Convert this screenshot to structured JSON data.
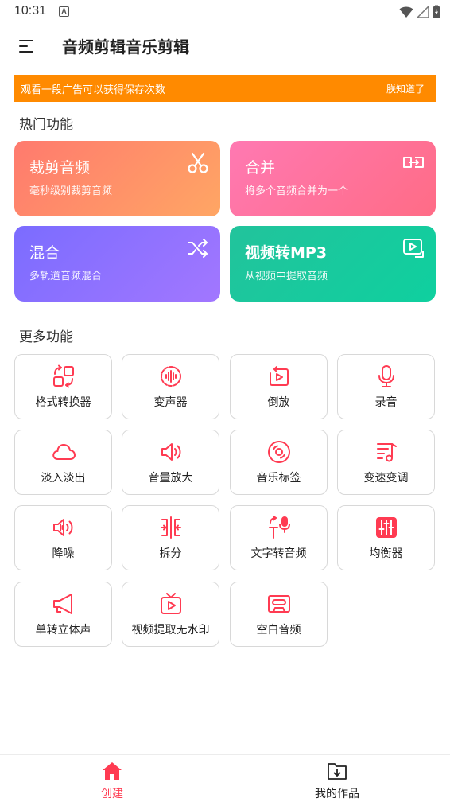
{
  "status_bar": {
    "time": "10:31",
    "notification_letter": "A"
  },
  "app_bar": {
    "title": "音频剪辑音乐剪辑"
  },
  "banner": {
    "text": "观看一段广告可以获得保存次数",
    "button": "朕知道了"
  },
  "hot_section": {
    "title": "热门功能",
    "cards": [
      {
        "title": "裁剪音频",
        "subtitle": "毫秒级别裁剪音频",
        "icon": "scissors-icon"
      },
      {
        "title": "合并",
        "subtitle": "将多个音频合并为一个",
        "icon": "merge-icon"
      },
      {
        "title": "混合",
        "subtitle": "多轨道音频混合",
        "icon": "shuffle-icon"
      },
      {
        "title": "视频转MP3",
        "subtitle": "从视频中提取音频",
        "icon": "video-to-audio-icon"
      }
    ]
  },
  "more_section": {
    "title": "更多功能",
    "tools": [
      {
        "label": "格式转换器",
        "icon": "format-convert-icon"
      },
      {
        "label": "变声器",
        "icon": "voice-changer-icon"
      },
      {
        "label": "倒放",
        "icon": "reverse-play-icon"
      },
      {
        "label": "录音",
        "icon": "microphone-icon"
      },
      {
        "label": "淡入淡出",
        "icon": "cloud-icon"
      },
      {
        "label": "音量放大",
        "icon": "volume-icon"
      },
      {
        "label": "音乐标签",
        "icon": "disc-icon"
      },
      {
        "label": "变速变调",
        "icon": "music-note-icon"
      },
      {
        "label": "降噪",
        "icon": "noise-reduction-icon"
      },
      {
        "label": "拆分",
        "icon": "split-icon"
      },
      {
        "label": "文字转音频",
        "icon": "text-to-speech-icon"
      },
      {
        "label": "均衡器",
        "icon": "equalizer-icon"
      },
      {
        "label": "单转立体声",
        "icon": "stereo-speaker-icon"
      },
      {
        "label": "视频提取无水印",
        "icon": "tv-play-icon"
      },
      {
        "label": "空白音频",
        "icon": "cassette-icon"
      }
    ]
  },
  "bottom_nav": {
    "items": [
      {
        "label": "创建",
        "icon": "home-icon",
        "active": true
      },
      {
        "label": "我的作品",
        "icon": "download-folder-icon",
        "active": false
      }
    ]
  },
  "colors": {
    "accent": "#ff3b52",
    "banner": "#ff8a00"
  }
}
